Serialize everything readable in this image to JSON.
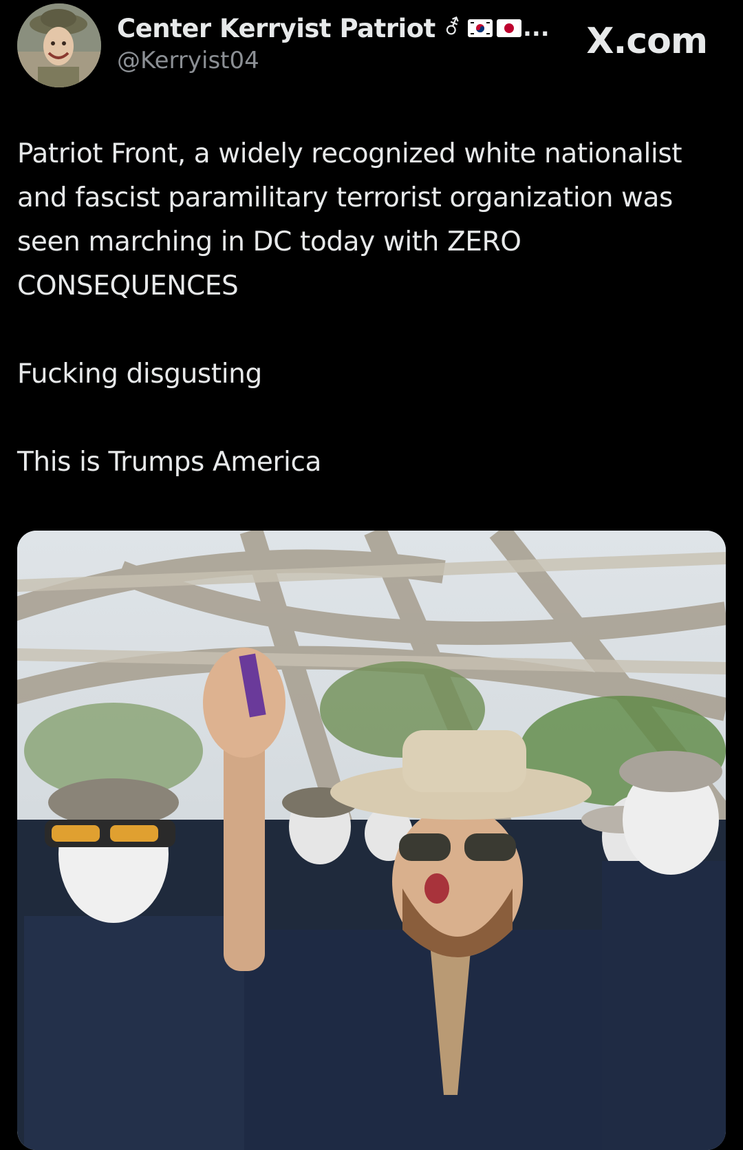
{
  "post": {
    "display_name": "Center Kerryist Patriot",
    "gender_symbol": "⚦",
    "flags": [
      "south-korea-flag",
      "japan-flag"
    ],
    "ellipsis": "...",
    "handle": "@Kerryist04",
    "site": "X.com",
    "text_paragraphs": [
      "Patriot Front, a widely recognized white nationalist and fascist paramilitary terrorist organization was seen marching in DC today with ZERO CONSEQUENCES",
      "Fucking disgusting",
      "This is Trumps America"
    ]
  },
  "media": {
    "kind": "photo",
    "icon": "photo-attachment"
  },
  "colors": {
    "background": "#000000",
    "primary_text": "#e7e9ea",
    "secondary_text": "#8b8f94"
  }
}
